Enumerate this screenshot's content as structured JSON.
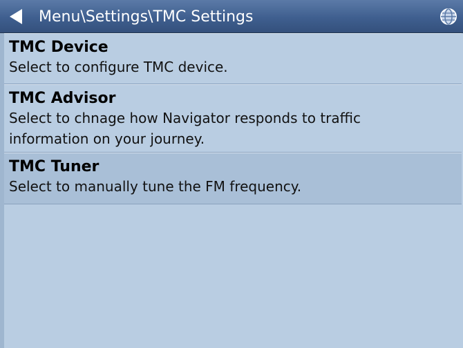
{
  "header": {
    "breadcrumb": "Menu\\Settings\\TMC Settings",
    "back_icon": "back-arrow-icon",
    "globe_icon": "globe-icon"
  },
  "menu": {
    "items": [
      {
        "title": "TMC Device",
        "description": "Select to configure TMC device."
      },
      {
        "title": "TMC Advisor",
        "description": "Select to chnage how Navigator responds to traffic information on your journey."
      },
      {
        "title": "TMC Tuner",
        "description": "Select to manually tune the FM frequency.",
        "selected": true
      }
    ]
  },
  "colors": {
    "header": "#3f5f8f",
    "background": "#b9cde2",
    "selected": "#a9bfd7"
  }
}
